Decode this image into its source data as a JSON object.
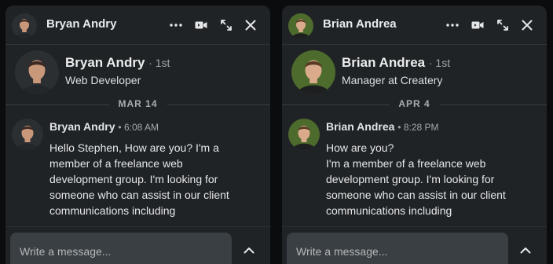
{
  "chats": [
    {
      "header": {
        "name": "Bryan Andry"
      },
      "profile": {
        "name": "Bryan Andry",
        "degree": "· 1st",
        "headline": "Web Developer"
      },
      "date": "MAR 14",
      "message": {
        "sender": "Bryan Andry",
        "time": "• 6:08 AM",
        "text": "Hello Stephen, How are you? I'm a member of a freelance web development group. I'm looking for someone who can assist in our client communications including"
      },
      "composer": {
        "placeholder": "Write a message..."
      },
      "avatar_palette": {
        "bg": "#2c2f31",
        "skin": "#c9977a",
        "hair": "#3b2a22",
        "shirt": "#23262a"
      }
    },
    {
      "header": {
        "name": "Brian Andrea"
      },
      "profile": {
        "name": "Brian Andrea",
        "degree": "· 1st",
        "headline": "Manager at Createry"
      },
      "date": "APR 4",
      "message": {
        "sender": "Brian Andrea",
        "time": "• 8:28 PM",
        "text": "How are you?\nI'm a member of a freelance web development group. I'm looking for someone who can assist in our client communications including"
      },
      "composer": {
        "placeholder": "Write a message..."
      },
      "avatar_palette": {
        "bg": "#4d6b2c",
        "skin": "#d9ab8c",
        "hair": "#5a3c26",
        "shirt": "#1e1f20"
      }
    }
  ],
  "icons": {
    "more": "more-horizontal-icon",
    "video": "video-call-icon",
    "expand": "expand-icon",
    "close": "close-icon",
    "collapse": "chevron-up-icon"
  },
  "colors": {
    "panel": "#1f2326",
    "page": "#0b0c0d",
    "input": "#3a3f43"
  }
}
